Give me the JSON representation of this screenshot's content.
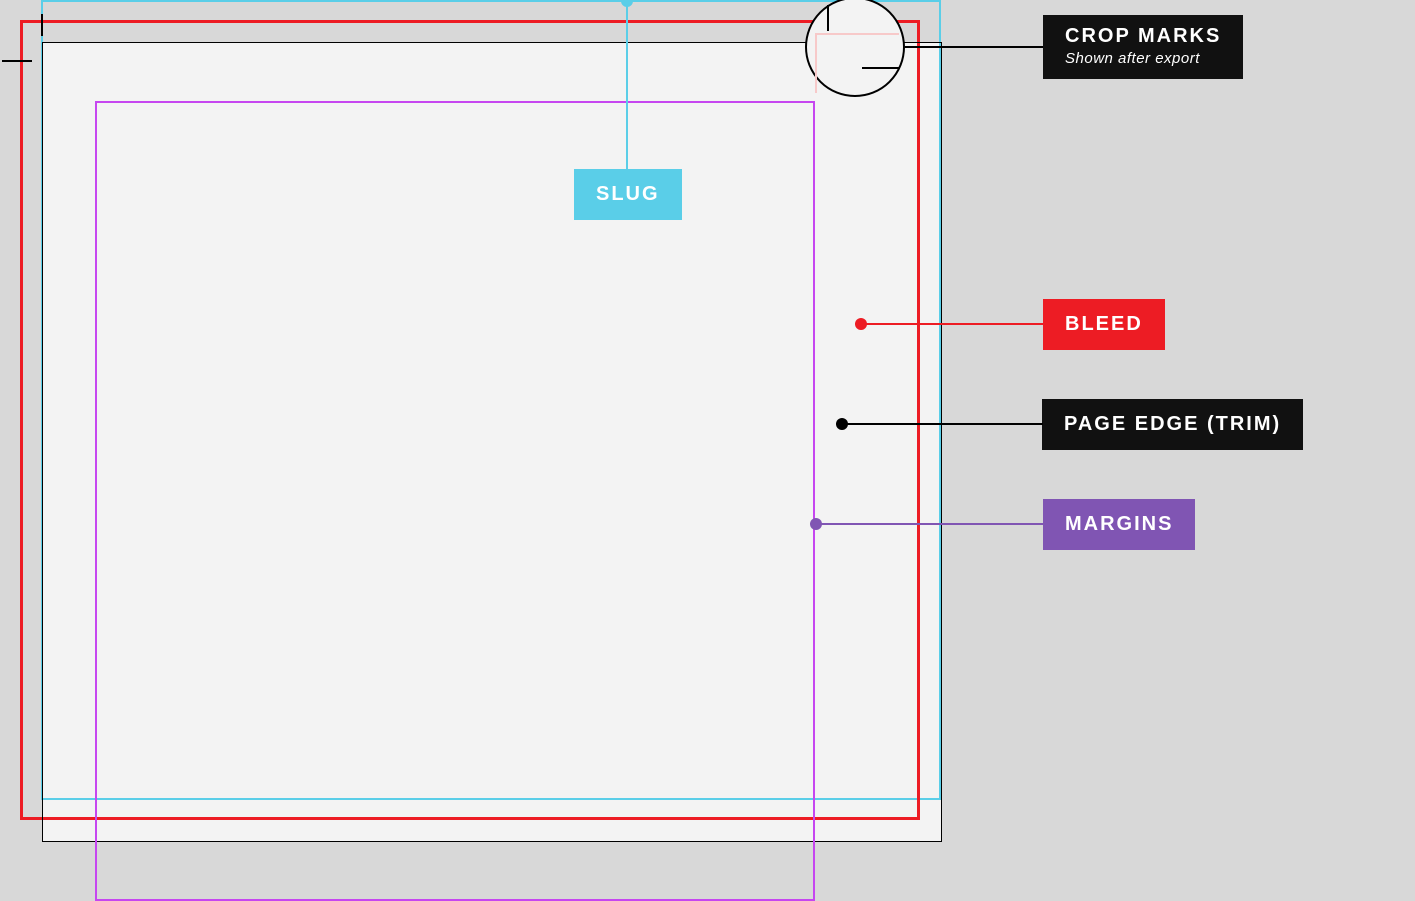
{
  "labels": {
    "slug": "SLUG",
    "crop_marks": "CROP MARKS",
    "crop_marks_sub": "Shown after export",
    "bleed": "BLEED",
    "page_edge": "PAGE EDGE (TRIM)",
    "margins": "MARGINS"
  },
  "colors": {
    "slug": "#5acee8",
    "bleed": "#ed1c24",
    "trim": "#000000",
    "margins_border": "#c646f0",
    "margins_label": "#8055b3",
    "dark": "#111111",
    "bg": "#d8d8d8",
    "page_bg": "#f3f3f3"
  },
  "diagram": {
    "type": "print-document-anatomy",
    "parts": [
      "slug",
      "bleed",
      "trim",
      "margins",
      "crop-marks"
    ]
  }
}
